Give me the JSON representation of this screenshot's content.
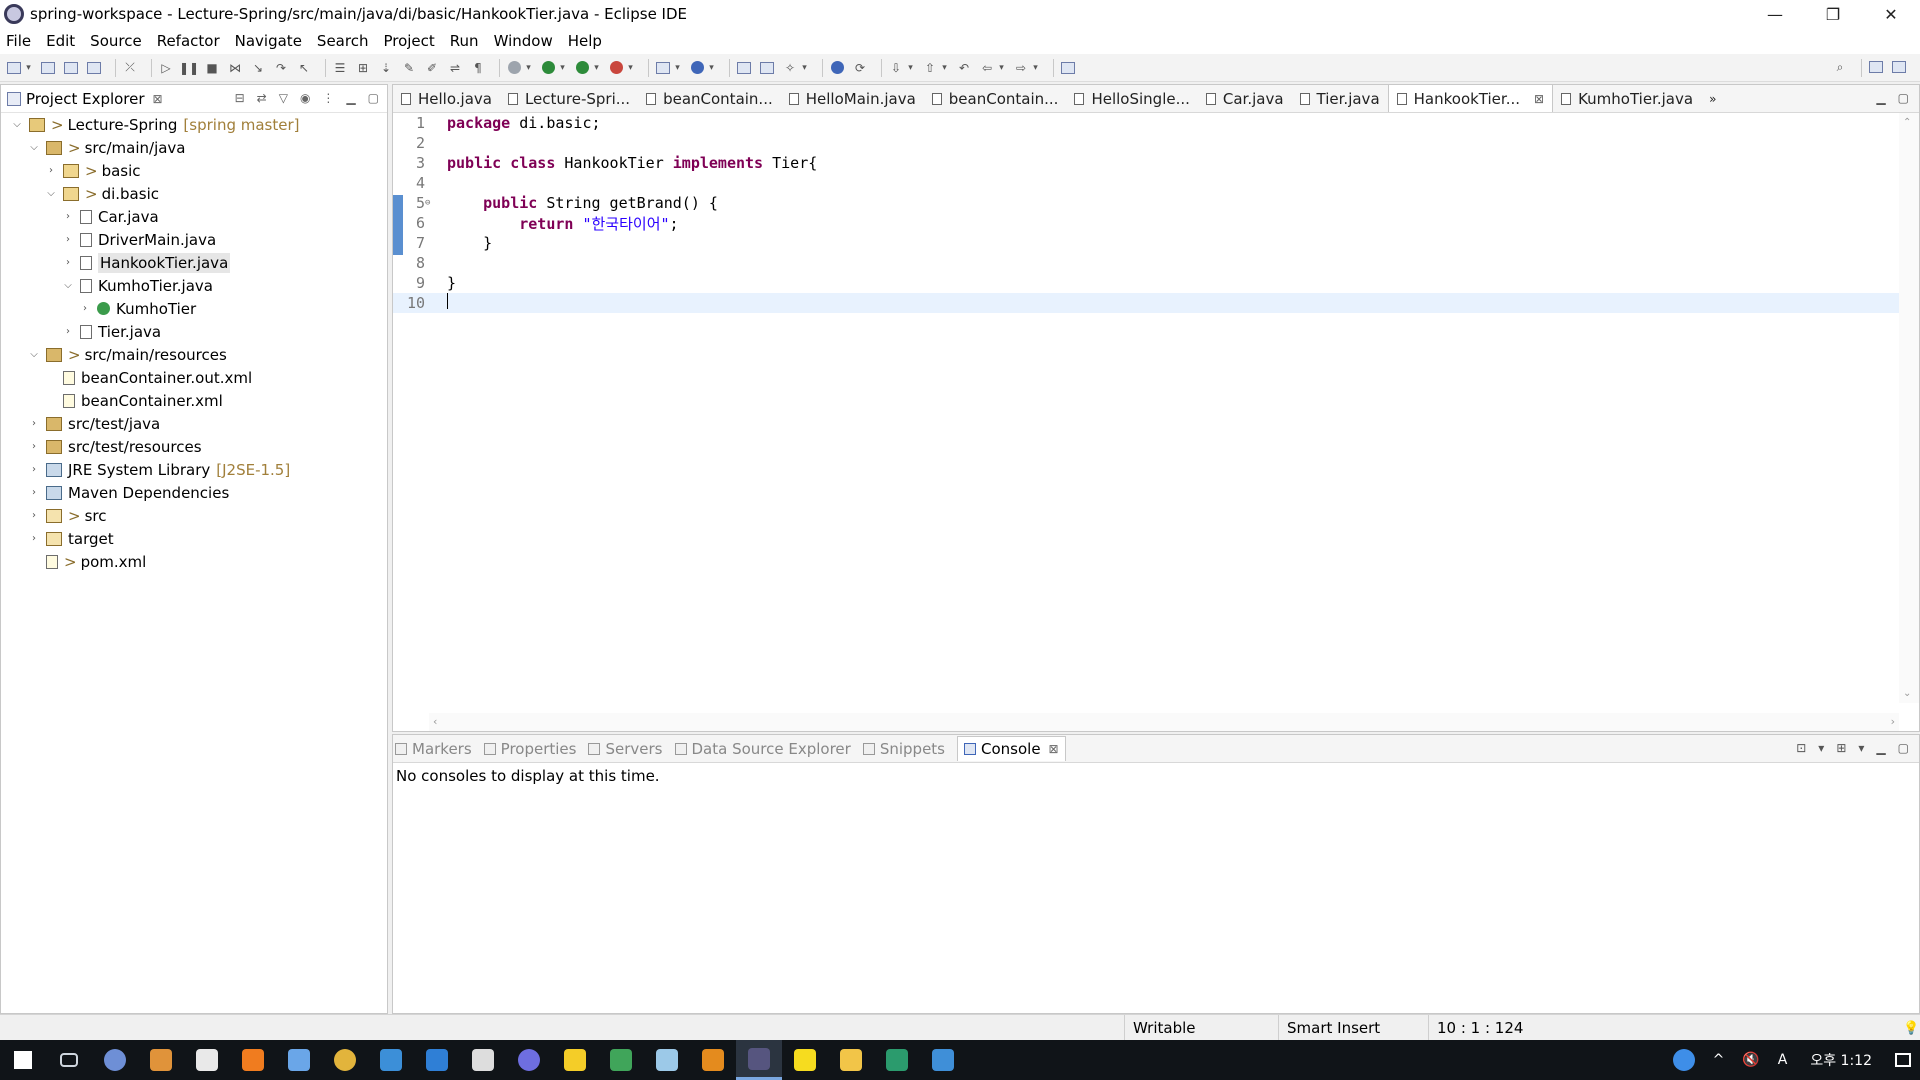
{
  "window": {
    "title": "spring-workspace - Lecture-Spring/src/main/java/di/basic/HankookTier.java - Eclipse IDE",
    "minimize": "—",
    "restore": "❐",
    "close": "✕"
  },
  "menu": [
    "File",
    "Edit",
    "Source",
    "Refactor",
    "Navigate",
    "Search",
    "Project",
    "Run",
    "Window",
    "Help"
  ],
  "explorer": {
    "title": "Project Explorer",
    "close": "⊠",
    "tree": [
      {
        "depth": 0,
        "toggle": "⌵",
        "icon": "project",
        "dec": ">",
        "label": "Lecture-Spring",
        "extra": "[spring master]"
      },
      {
        "depth": 1,
        "toggle": "⌵",
        "icon": "pkgroot",
        "dec": ">",
        "label": "src/main/java",
        "extra": ""
      },
      {
        "depth": 2,
        "toggle": "›",
        "icon": "pkg",
        "dec": ">",
        "label": "basic",
        "extra": ""
      },
      {
        "depth": 2,
        "toggle": "⌵",
        "icon": "pkg",
        "dec": ">",
        "label": "di.basic",
        "extra": ""
      },
      {
        "depth": 3,
        "toggle": "›",
        "icon": "java",
        "dec": "",
        "label": "Car.java",
        "extra": ""
      },
      {
        "depth": 3,
        "toggle": "›",
        "icon": "java",
        "dec": "",
        "label": "DriverMain.java",
        "extra": ""
      },
      {
        "depth": 3,
        "toggle": "›",
        "icon": "java",
        "dec": "",
        "label": "HankookTier.java",
        "extra": "",
        "selected": true
      },
      {
        "depth": 3,
        "toggle": "⌵",
        "icon": "java",
        "dec": "",
        "label": "KumhoTier.java",
        "extra": ""
      },
      {
        "depth": 4,
        "toggle": "›",
        "icon": "cls",
        "dec": "",
        "label": "KumhoTier",
        "extra": ""
      },
      {
        "depth": 3,
        "toggle": "›",
        "icon": "java",
        "dec": "",
        "label": "Tier.java",
        "extra": ""
      },
      {
        "depth": 1,
        "toggle": "⌵",
        "icon": "pkgroot",
        "dec": ">",
        "label": "src/main/resources",
        "extra": ""
      },
      {
        "depth": 2,
        "toggle": "",
        "icon": "xml",
        "dec": "",
        "label": "beanContainer.out.xml",
        "extra": ""
      },
      {
        "depth": 2,
        "toggle": "",
        "icon": "xml",
        "dec": "",
        "label": "beanContainer.xml",
        "extra": ""
      },
      {
        "depth": 1,
        "toggle": "›",
        "icon": "pkgroot",
        "dec": "",
        "label": "src/test/java",
        "extra": ""
      },
      {
        "depth": 1,
        "toggle": "›",
        "icon": "pkgroot",
        "dec": "",
        "label": "src/test/resources",
        "extra": ""
      },
      {
        "depth": 1,
        "toggle": "›",
        "icon": "lib",
        "dec": "",
        "label": "JRE System Library",
        "extra": "[J2SE-1.5]"
      },
      {
        "depth": 1,
        "toggle": "›",
        "icon": "lib",
        "dec": "",
        "label": "Maven Dependencies",
        "extra": ""
      },
      {
        "depth": 1,
        "toggle": "›",
        "icon": "folder",
        "dec": ">",
        "label": "src",
        "extra": ""
      },
      {
        "depth": 1,
        "toggle": "›",
        "icon": "folder",
        "dec": "",
        "label": "target",
        "extra": ""
      },
      {
        "depth": 1,
        "toggle": "",
        "icon": "xml",
        "dec": ">",
        "label": "pom.xml",
        "extra": ""
      }
    ]
  },
  "editor": {
    "tabs": [
      {
        "label": "Hello.java",
        "active": false
      },
      {
        "label": "Lecture-Spri...",
        "active": false
      },
      {
        "label": "beanContain...",
        "active": false
      },
      {
        "label": "HelloMain.java",
        "active": false
      },
      {
        "label": "beanContain...",
        "active": false
      },
      {
        "label": "HelloSingle...",
        "active": false
      },
      {
        "label": "Car.java",
        "active": false
      },
      {
        "label": "Tier.java",
        "active": false
      },
      {
        "label": "HankookTier...",
        "active": true
      },
      {
        "label": "KumhoTier.java",
        "active": false
      }
    ],
    "more_tabs": "»",
    "current_line": 10,
    "lines": [
      {
        "n": "1",
        "fold": "",
        "tokens": [
          {
            "t": "package",
            "c": "kw"
          },
          {
            "t": " di.basic;",
            "c": ""
          }
        ]
      },
      {
        "n": "2",
        "fold": "",
        "tokens": []
      },
      {
        "n": "3",
        "fold": "",
        "tokens": [
          {
            "t": "public class",
            "c": "kw"
          },
          {
            "t": " HankookTier ",
            "c": ""
          },
          {
            "t": "implements",
            "c": "kw"
          },
          {
            "t": " Tier{",
            "c": ""
          }
        ]
      },
      {
        "n": "4",
        "fold": "",
        "tokens": []
      },
      {
        "n": "5",
        "fold": "⊖",
        "tokens": [
          {
            "t": "    ",
            "c": ""
          },
          {
            "t": "public",
            "c": "kw"
          },
          {
            "t": " String getBrand() {",
            "c": ""
          }
        ]
      },
      {
        "n": "6",
        "fold": "",
        "tokens": [
          {
            "t": "        ",
            "c": ""
          },
          {
            "t": "return",
            "c": "kw"
          },
          {
            "t": " ",
            "c": ""
          },
          {
            "t": "\"한국타이어\"",
            "c": "str"
          },
          {
            "t": ";",
            "c": ""
          }
        ]
      },
      {
        "n": "7",
        "fold": "",
        "tokens": [
          {
            "t": "    }",
            "c": ""
          }
        ]
      },
      {
        "n": "8",
        "fold": "",
        "tokens": []
      },
      {
        "n": "9",
        "fold": "",
        "tokens": [
          {
            "t": "}",
            "c": ""
          }
        ]
      },
      {
        "n": "10",
        "fold": "",
        "tokens": []
      }
    ]
  },
  "panel": {
    "tabs": [
      {
        "label": "Markers",
        "active": false
      },
      {
        "label": "Properties",
        "active": false
      },
      {
        "label": "Servers",
        "active": false
      },
      {
        "label": "Data Source Explorer",
        "active": false
      },
      {
        "label": "Snippets",
        "active": false
      },
      {
        "label": "Console",
        "active": true
      }
    ],
    "console_message": "No consoles to display at this time."
  },
  "status": {
    "writable": "Writable",
    "insert_mode": "Smart Insert",
    "position": "10 : 1 : 124"
  },
  "taskbar": {
    "tray_lang": "A",
    "tray_volume": "🔇",
    "tray_up": "^",
    "time": "오후 1:12",
    "apps": [
      {
        "name": "windows-start",
        "color": "#ffffff"
      },
      {
        "name": "task-view",
        "color": "#cfd6de"
      },
      {
        "name": "profile-r",
        "color": "#6e8fd6"
      },
      {
        "name": "app-w",
        "color": "#e0933a"
      },
      {
        "name": "app-bookmark",
        "color": "#e9e9e9"
      },
      {
        "name": "app-search",
        "color": "#f07c1f"
      },
      {
        "name": "app-network",
        "color": "#6aa6e8"
      },
      {
        "name": "chrome",
        "color": "#e2b43c"
      },
      {
        "name": "ie",
        "color": "#3c8fd8"
      },
      {
        "name": "edge",
        "color": "#2f7fd6"
      },
      {
        "name": "app-gear",
        "color": "#dddddd"
      },
      {
        "name": "app-disc",
        "color": "#6e6ee0"
      },
      {
        "name": "app-sticky",
        "color": "#f4cd28"
      },
      {
        "name": "app-green",
        "color": "#40a55a"
      },
      {
        "name": "app-docs",
        "color": "#9cc9e8"
      },
      {
        "name": "app-orange",
        "color": "#e48b1e"
      },
      {
        "name": "eclipse",
        "color": "#56557f",
        "active": true
      },
      {
        "name": "kakaotalk",
        "color": "#f6dc1f"
      },
      {
        "name": "explorer",
        "color": "#f2c548"
      },
      {
        "name": "app-vs",
        "color": "#2b9b6d"
      },
      {
        "name": "app-photo",
        "color": "#3f8fd8"
      }
    ]
  }
}
